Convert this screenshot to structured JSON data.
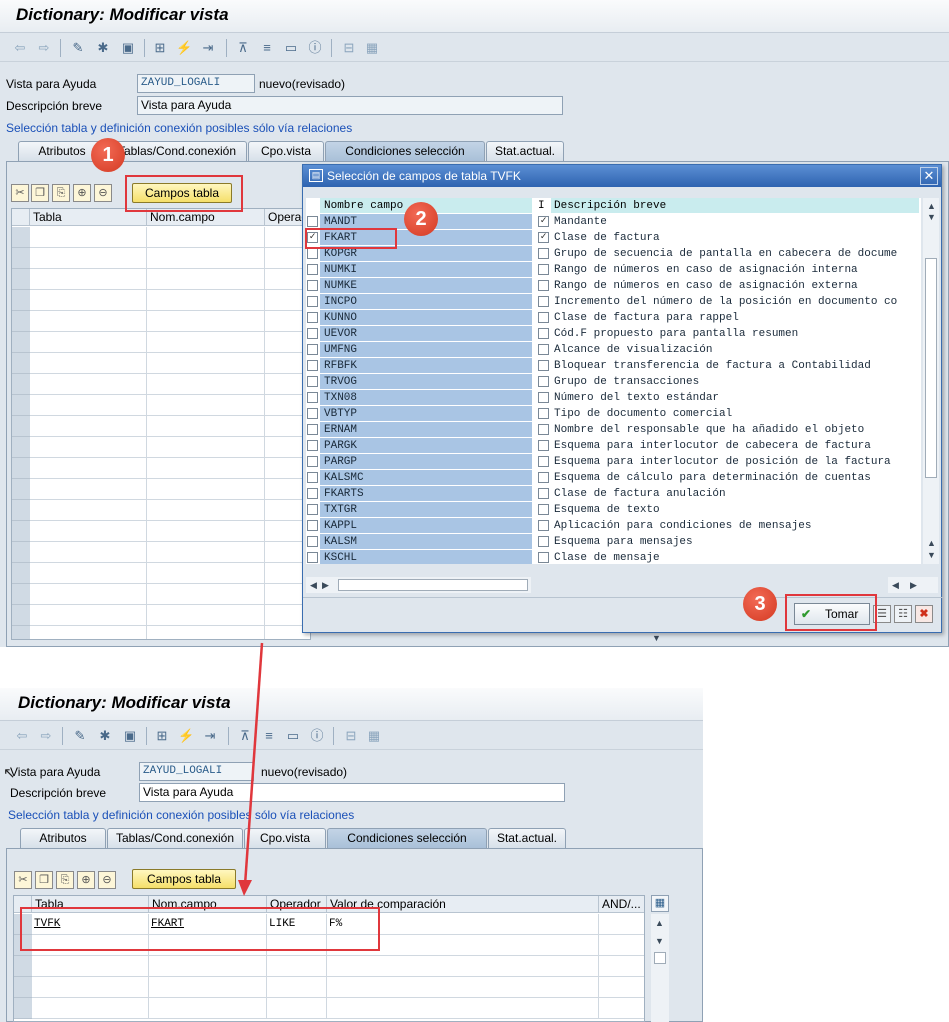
{
  "top": {
    "title": "Dictionary: Modificar vista",
    "vista_label": "Vista para Ayuda",
    "vista_value": "ZAYUD_LOGALI",
    "vista_status": "nuevo(revisado)",
    "desc_label": "Descripción breve",
    "desc_value": "Vista para Ayuda",
    "info": "Selección tabla y definición conexión posibles sólo vía relaciones",
    "tabs": [
      "Atributos",
      "Tablas/Cond.conexión",
      "Cpo.vista",
      "Condiciones selección",
      "Stat.actual."
    ],
    "campos_btn": "Campos tabla",
    "cols": [
      "Tabla",
      "Nom.campo",
      "Operad"
    ]
  },
  "dialog": {
    "title": "Selección de campos de tabla TVFK",
    "header_name": "Nombre campo",
    "header_i": "I",
    "header_desc": "Descripción breve",
    "tomar": "Tomar",
    "rows": [
      {
        "name": "MANDT",
        "checked": false,
        "key": true,
        "desc": "Mandante"
      },
      {
        "name": "FKART",
        "checked": true,
        "key": true,
        "desc": "Clase de factura"
      },
      {
        "name": "KOPGR",
        "checked": false,
        "key": false,
        "desc": "Grupo de secuencia de pantalla en cabecera de docume"
      },
      {
        "name": "NUMKI",
        "checked": false,
        "key": false,
        "desc": "Rango de números en caso de asignación interna"
      },
      {
        "name": "NUMKE",
        "checked": false,
        "key": false,
        "desc": "Rango de números en caso de asignación externa"
      },
      {
        "name": "INCPO",
        "checked": false,
        "key": false,
        "desc": "Incremento del número de la posición en documento co"
      },
      {
        "name": "KUNNO",
        "checked": false,
        "key": false,
        "desc": "Clase de factura para rappel"
      },
      {
        "name": "UEVOR",
        "checked": false,
        "key": false,
        "desc": "Cód.F propuesto para pantalla resumen"
      },
      {
        "name": "UMFNG",
        "checked": false,
        "key": false,
        "desc": "Alcance de visualización"
      },
      {
        "name": "RFBFK",
        "checked": false,
        "key": false,
        "desc": "Bloquear transferencia de factura a Contabilidad"
      },
      {
        "name": "TRVOG",
        "checked": false,
        "key": false,
        "desc": "Grupo de transacciones"
      },
      {
        "name": "TXN08",
        "checked": false,
        "key": false,
        "desc": "Número del texto estándar"
      },
      {
        "name": "VBTYP",
        "checked": false,
        "key": false,
        "desc": "Tipo de documento comercial"
      },
      {
        "name": "ERNAM",
        "checked": false,
        "key": false,
        "desc": "Nombre del responsable que ha añadido el objeto"
      },
      {
        "name": "PARGK",
        "checked": false,
        "key": false,
        "desc": "Esquema para interlocutor de cabecera de factura"
      },
      {
        "name": "PARGP",
        "checked": false,
        "key": false,
        "desc": "Esquema para interlocutor de posición de la factura"
      },
      {
        "name": "KALSMC",
        "checked": false,
        "key": false,
        "desc": "Esquema de cálculo para determinación de cuentas"
      },
      {
        "name": "FKARTS",
        "checked": false,
        "key": false,
        "desc": "Clase de factura anulación"
      },
      {
        "name": "TXTGR",
        "checked": false,
        "key": false,
        "desc": "Esquema de texto"
      },
      {
        "name": "KAPPL",
        "checked": false,
        "key": false,
        "desc": "Aplicación para condiciones de mensajes"
      },
      {
        "name": "KALSM",
        "checked": false,
        "key": false,
        "desc": "Esquema para mensajes"
      },
      {
        "name": "KSCHL",
        "checked": false,
        "key": false,
        "desc": "Clase de mensaje"
      }
    ]
  },
  "bottom": {
    "title": "Dictionary: Modificar vista",
    "vista_label": "Vista para Ayuda",
    "vista_value": "ZAYUD_LOGALI",
    "vista_status": "nuevo(revisado)",
    "desc_label": "Descripción breve",
    "desc_value": "Vista para Ayuda",
    "info": "Selección tabla y definición conexión posibles sólo vía relaciones",
    "tabs": [
      "Atributos",
      "Tablas/Cond.conexión",
      "Cpo.vista",
      "Condiciones selección",
      "Stat.actual."
    ],
    "campos_btn": "Campos tabla",
    "cols": [
      "Tabla",
      "Nom.campo",
      "Operador",
      "Valor de comparación",
      "AND/..."
    ],
    "row": {
      "tabla": "TVFK",
      "campo": "FKART",
      "operador": "LIKE",
      "valor": "F%"
    }
  },
  "badges": [
    "1",
    "2",
    "3"
  ]
}
